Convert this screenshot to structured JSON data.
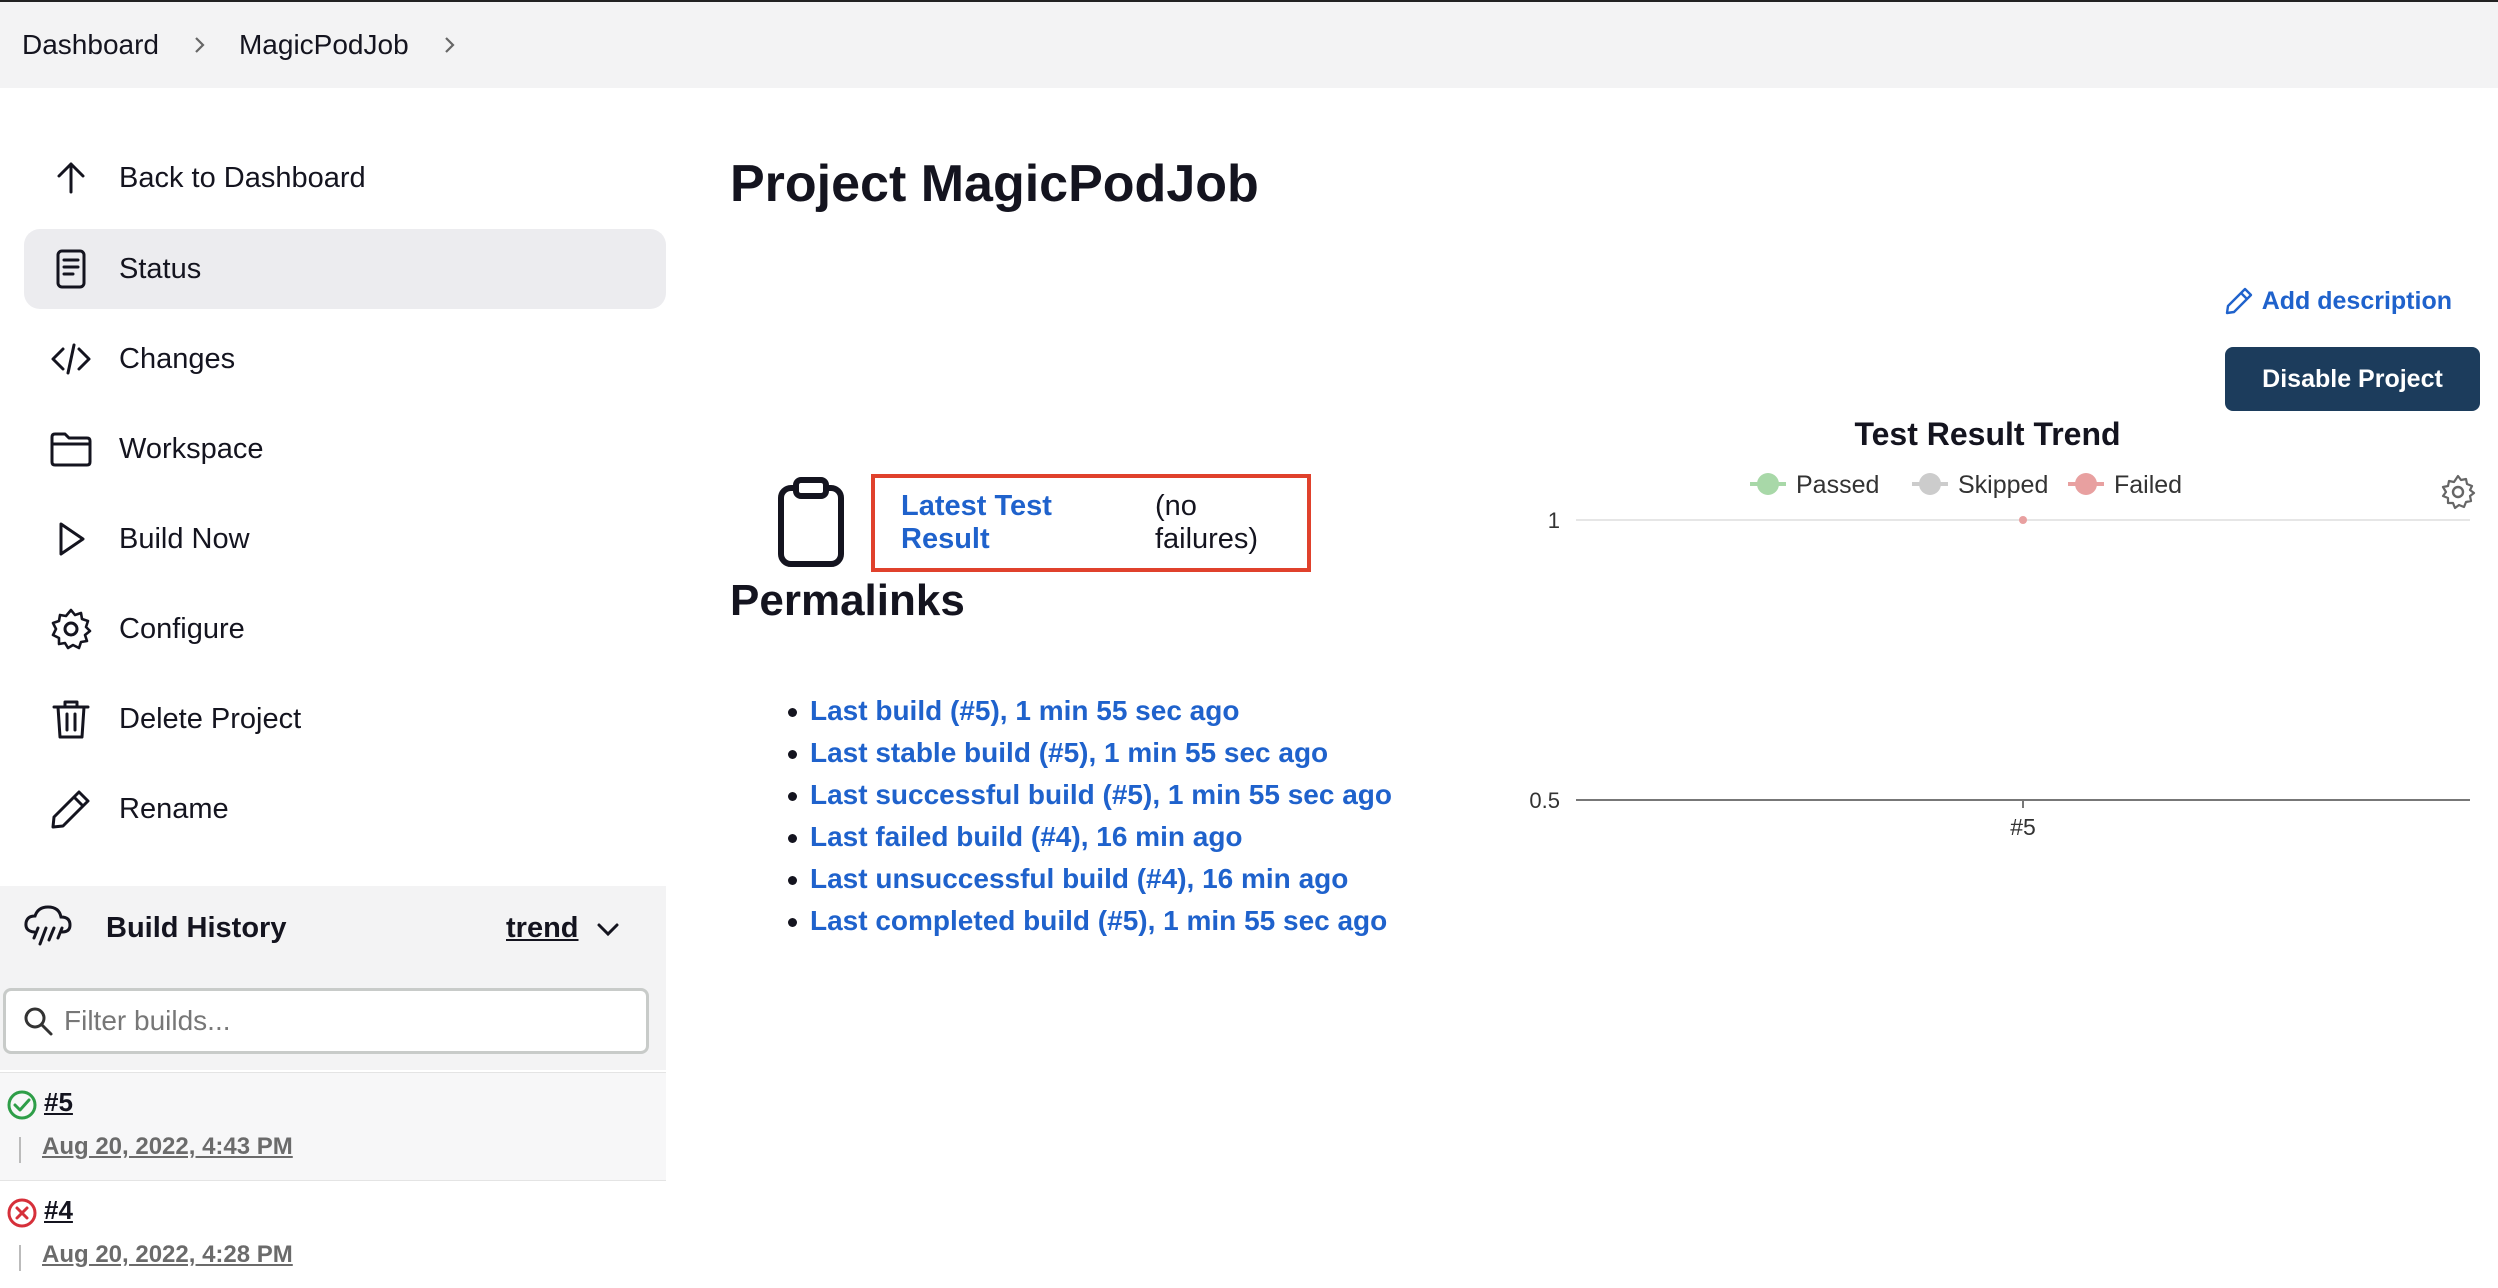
{
  "breadcrumb": {
    "items": [
      "Dashboard",
      "MagicPodJob"
    ]
  },
  "sidebar": {
    "items": [
      {
        "label": "Back to Dashboard",
        "icon": "arrow-up-icon"
      },
      {
        "label": "Status",
        "icon": "document-icon",
        "active": true
      },
      {
        "label": "Changes",
        "icon": "code-icon"
      },
      {
        "label": "Workspace",
        "icon": "folder-icon"
      },
      {
        "label": "Build Now",
        "icon": "play-icon"
      },
      {
        "label": "Configure",
        "icon": "gear-icon"
      },
      {
        "label": "Delete Project",
        "icon": "trash-icon"
      },
      {
        "label": "Rename",
        "icon": "pencil-icon"
      }
    ]
  },
  "build_history": {
    "title": "Build History",
    "trend_label": "trend",
    "filter_placeholder": "Filter builds...",
    "builds": [
      {
        "number": "#5",
        "date": "Aug 20, 2022, 4:43 PM",
        "status": "success"
      },
      {
        "number": "#4",
        "date": "Aug 20, 2022, 4:28 PM",
        "status": "failed"
      }
    ]
  },
  "main": {
    "title": "Project MagicPodJob",
    "add_description": "Add description",
    "disable_button": "Disable Project",
    "latest_test_result": {
      "link": "Latest Test Result",
      "suffix": "(no failures)"
    },
    "permalinks_title": "Permalinks",
    "permalinks": [
      "Last build (#5), 1 min 55 sec ago",
      "Last stable build (#5), 1 min 55 sec ago",
      "Last successful build (#5), 1 min 55 sec ago",
      "Last failed build (#4), 16 min ago",
      "Last unsuccessful build (#4), 16 min ago",
      "Last completed build (#5), 1 min 55 sec ago"
    ]
  },
  "colors": {
    "link": "#1f62cc",
    "button_bg": "#1c3c5c",
    "highlight_border": "#e0412c",
    "passed": "#a8d8a8",
    "skipped": "#cccccc",
    "failed": "#e8a0a0"
  },
  "chart_data": {
    "type": "line",
    "title": "Test Result Trend",
    "categories": [
      "#5"
    ],
    "series": [
      {
        "name": "Passed",
        "values": [
          1
        ],
        "color": "#a8d8a8"
      },
      {
        "name": "Skipped",
        "values": [
          0
        ],
        "color": "#cccccc"
      },
      {
        "name": "Failed",
        "values": [
          0
        ],
        "color": "#e8a0a0"
      }
    ],
    "yticks": [
      "1",
      "0.5"
    ],
    "ylim": [
      0.5,
      1
    ],
    "legend": "top"
  }
}
